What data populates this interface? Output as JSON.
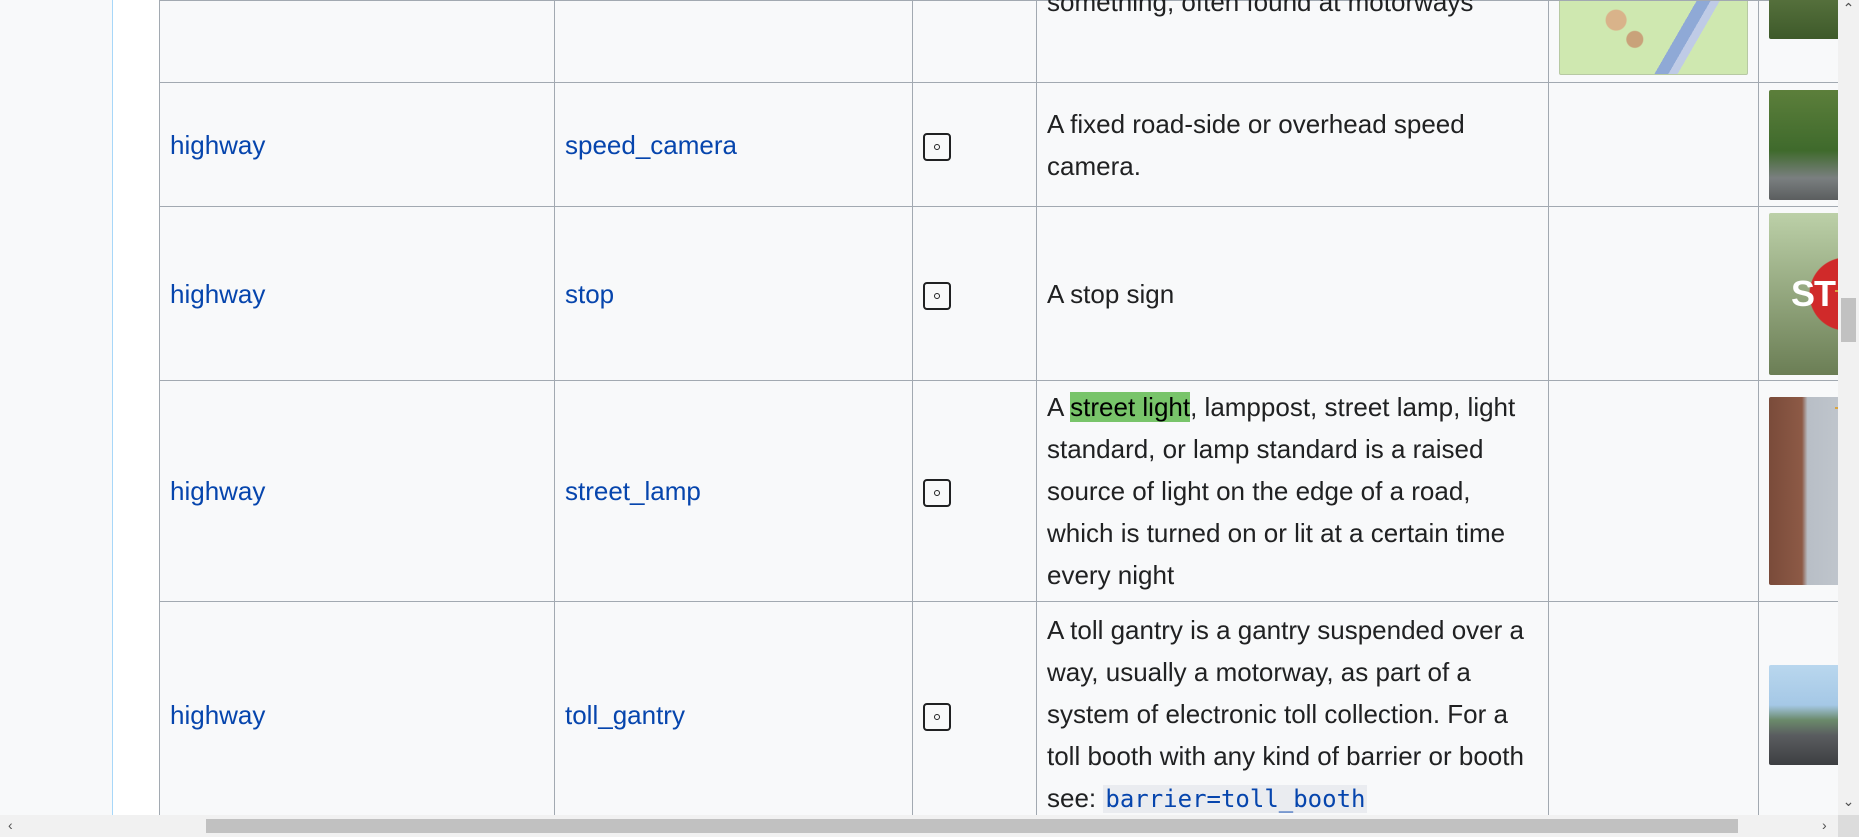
{
  "rows": [
    {
      "key": "",
      "value": "",
      "icon": "",
      "description": "something, often found at motorways",
      "photo": "tree"
    },
    {
      "key": "highway",
      "value": "speed_camera",
      "icon": "node-icon",
      "description": "A fixed road-side or overhead speed camera.",
      "photo": "green"
    },
    {
      "key": "highway",
      "value": "stop",
      "icon": "node-icon",
      "description": "A stop sign",
      "photo": "stop"
    },
    {
      "key": "highway",
      "value": "street_lamp",
      "icon": "node-icon",
      "description_highlight": "street light",
      "description_pre": "A ",
      "description_post": ", lamppost, street lamp, light standard, or lamp standard is a raised source of light on the edge of a road, which is turned on or lit at a certain time every night",
      "photo": "building"
    },
    {
      "key": "highway",
      "value": "toll_gantry",
      "icon": "node-icon",
      "description": "A toll gantry is a gantry suspended over a way, usually a motorway, as part of a system of electronic toll collection. For a toll booth with any kind of barrier or booth see: ",
      "tag_key": "barrier",
      "tag_eq": "=",
      "tag_value": "toll_booth",
      "photo": "gantry"
    }
  ],
  "photo_text": {
    "stop": "ST"
  },
  "scrollbar": {
    "up": "⌃",
    "down": "⌄",
    "left": "‹",
    "right": "›"
  },
  "colors": {
    "link": "#0645ad",
    "highlight": "#78c46a",
    "table_bg": "#f8f9fa",
    "border": "#a2a9b1"
  }
}
